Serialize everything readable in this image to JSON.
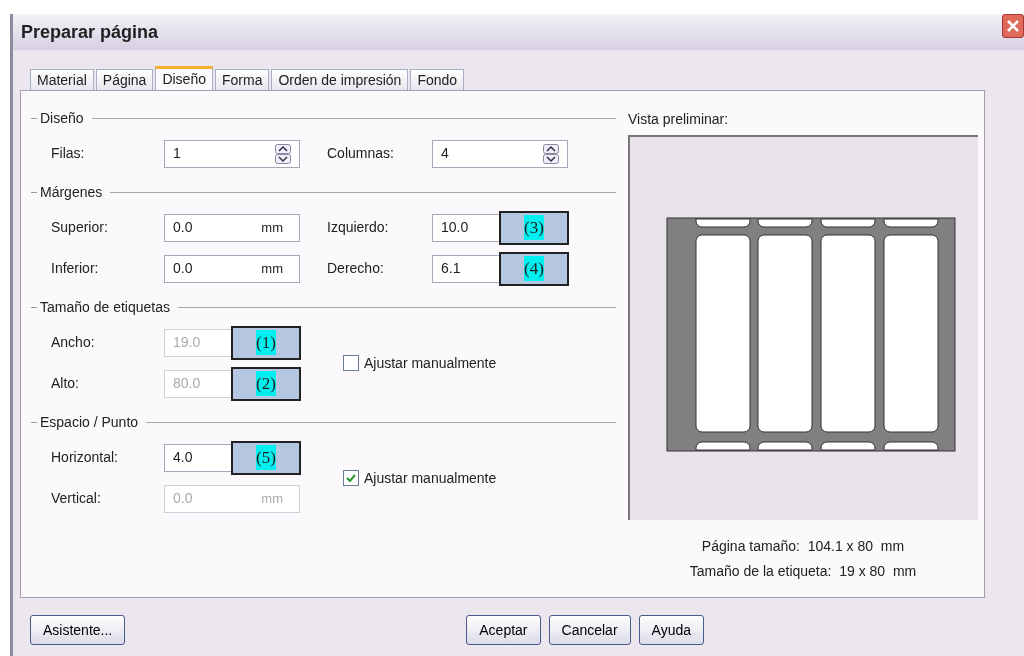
{
  "window": {
    "title": "Preparar página"
  },
  "tabs": [
    {
      "label": "Material",
      "selected": false
    },
    {
      "label": "Página",
      "selected": false
    },
    {
      "label": "Diseño",
      "selected": true
    },
    {
      "label": "Forma",
      "selected": false
    },
    {
      "label": "Orden de impresión",
      "selected": false
    },
    {
      "label": "Fondo",
      "selected": false
    }
  ],
  "sections": [
    {
      "title": "Diseño",
      "rows": [
        [
          {
            "label": "Filas:",
            "value": "1",
            "kind": "spin",
            "disabled": false
          },
          {
            "label": "Columnas:",
            "value": "4",
            "kind": "spin",
            "disabled": false
          }
        ]
      ]
    },
    {
      "title": "Márgenes",
      "rows": [
        [
          {
            "label": "Superior:",
            "value": "0.0",
            "unit": "mm",
            "kind": "text",
            "disabled": false
          },
          {
            "label": "Izquierdo:",
            "value": "10.0",
            "kind": "text",
            "disabled": false,
            "callout": "(3)"
          }
        ],
        [
          {
            "label": "Inferior:",
            "value": "0.0",
            "unit": "mm",
            "kind": "text",
            "disabled": false
          },
          {
            "label": "Derecho:",
            "value": "6.1",
            "kind": "text",
            "disabled": false,
            "callout": "(4)"
          }
        ]
      ]
    },
    {
      "title": "Tamaño de etiquetas",
      "rows": [
        [
          {
            "label": "Ancho:",
            "value": "19.0",
            "kind": "text",
            "disabled": true,
            "callout": "(1)"
          }
        ],
        [
          {
            "label": "Alto:",
            "value": "80.0",
            "kind": "text",
            "disabled": true,
            "callout": "(2)"
          }
        ]
      ],
      "checkbox": {
        "label": "Ajustar manualmente",
        "checked": false
      }
    },
    {
      "title": "Espacio / Punto",
      "rows": [
        [
          {
            "label": "Horizontal:",
            "value": "4.0",
            "kind": "text",
            "disabled": false,
            "callout": "(5)"
          }
        ],
        [
          {
            "label": "Vertical:",
            "value": "0.0",
            "unit": "mm",
            "kind": "text",
            "disabled": true
          }
        ]
      ],
      "checkbox": {
        "label": "Ajustar manualmente",
        "checked": true
      }
    }
  ],
  "preview": {
    "title": "Vista preliminar:",
    "captions": [
      "Página tamaño:  104.1 x 80  mm",
      "Tamaño de la etiqueta:  19 x 80  mm"
    ]
  },
  "buttons": {
    "left": [
      "Asistente..."
    ],
    "right": [
      "Aceptar",
      "Cancelar",
      "Ayuda"
    ]
  }
}
